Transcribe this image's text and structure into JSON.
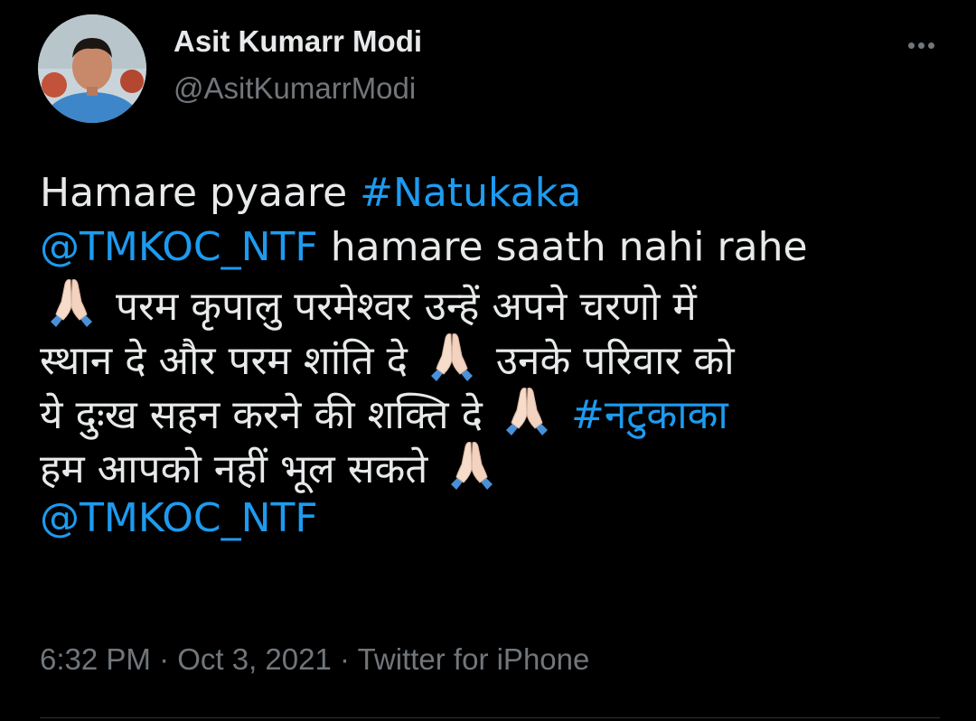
{
  "author": {
    "display_name": "Asit Kumarr Modi",
    "handle": "@AsitKumarrModi"
  },
  "tweet": {
    "line1_plain": "Hamare pyaare ",
    "line1_hashtag": "#Natukaka",
    "line2_mention": "@TMKOC_NTF",
    "line2_plain": " hamare saath nahi rahe",
    "line3_plain": " परम कृपालु परमेश्वर उन्हें अपने चरणो में",
    "line4_plain_a": "स्थान दे और परम शांति दे",
    "line4_plain_b": " उनके परिवार को",
    "line5_plain": "ये दुःख सहन करने की शक्ति दे",
    "line5_hashtag": "#नटुकाका",
    "line6_plain": "हम आपको नहीं भूल सकते",
    "line7_mention": "@TMKOC_NTF",
    "emoji_name": "folded-hands-icon"
  },
  "meta": {
    "time": "6:32 PM",
    "separator": " · ",
    "date": "Oct 3, 2021",
    "source": "Twitter for iPhone"
  },
  "colors": {
    "background": "#000000",
    "text": "#e7e9ea",
    "secondary": "#71767b",
    "link": "#1d9bf0"
  }
}
